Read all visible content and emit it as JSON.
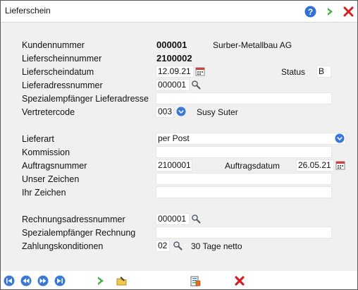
{
  "window": {
    "title": "Lieferschein"
  },
  "titlebar_icons": [
    "help-icon",
    "forward-arrow-icon",
    "close-icon"
  ],
  "labels": {
    "kundennummer": "Kundennummer",
    "lieferscheinnummer": "Lieferscheinnummer",
    "lieferscheindatum": "Lieferscheindatum",
    "lieferadressnummer": "Lieferadressnummer",
    "spezial_liefer": "Spezialempfänger Lieferadresse",
    "vertretercode": "Vertretercode",
    "lieferart": "Lieferart",
    "kommission": "Kommission",
    "auftragsnummer": "Auftragsnummer",
    "unser_zeichen": "Unser Zeichen",
    "ihr_zeichen": "Ihr Zeichen",
    "rechnungsadressnummer": "Rechnungsadressnummer",
    "spezial_rechnung": "Spezialempfänger Rechnung",
    "zahlungskonditionen": "Zahlungskonditionen",
    "status": "Status",
    "auftragsdatum": "Auftragsdatum"
  },
  "values": {
    "kundennummer": "000001",
    "kundenname": "Surber-Metallbau AG",
    "lieferscheinnummer": "2100002",
    "lieferscheindatum": "12.09.21",
    "status": "B",
    "lieferadressnummer": "000001",
    "spezial_liefer": "",
    "vertretercode": "003",
    "vertretername": "Susy Suter",
    "lieferart": "per Post",
    "kommission": "",
    "auftragsnummer": "2100001",
    "auftragsdatum": "26.05.21",
    "unser_zeichen": "",
    "ihr_zeichen": "",
    "rechnungsadressnummer": "000001",
    "spezial_rechnung": "",
    "zahlungskonditionen": "02",
    "zahlungstext": "30 Tage netto"
  },
  "colors": {
    "accent_blue": "#2f6fd6",
    "green_arrow": "#3cb43c",
    "red_close": "#d62020"
  }
}
